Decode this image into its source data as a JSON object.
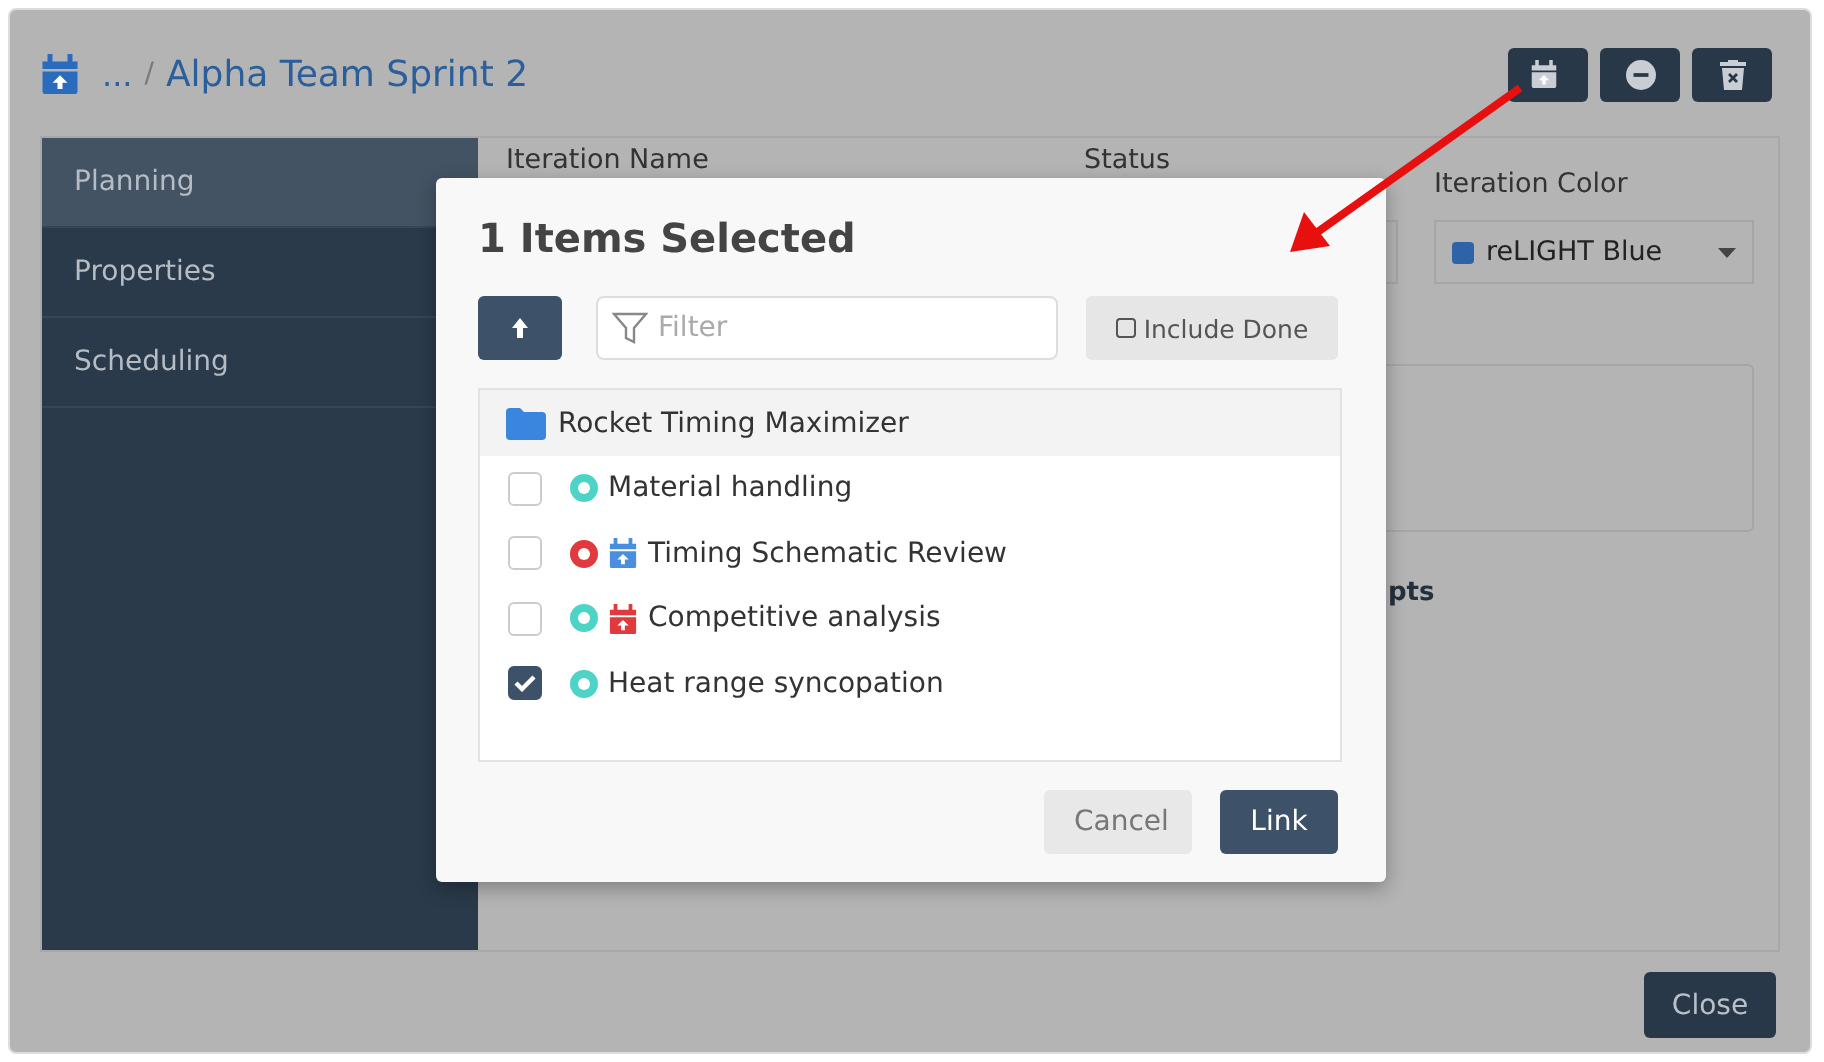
{
  "window": {
    "breadcrumb_ellipsis": "...",
    "breadcrumb_separator": "/",
    "title": "Alpha Team Sprint 2"
  },
  "sidebar": {
    "items": [
      {
        "label": "Planning",
        "selected": true
      },
      {
        "label": "Properties",
        "selected": false
      },
      {
        "label": "Scheduling",
        "selected": false
      }
    ]
  },
  "form": {
    "name_label": "Iteration Name",
    "status_label": "Status",
    "color_label": "Iteration Color",
    "color_value": "reLIGHT Blue",
    "section_heading_tail": "pts"
  },
  "dialog": {
    "title": "1 Items Selected",
    "filter": {
      "placeholder": "Filter"
    },
    "include_done": {
      "label": "Include Done",
      "checked": false
    },
    "group": "Rocket Timing Maximizer",
    "items": [
      {
        "label": "Material handling",
        "checked": false,
        "color": "#4dd4c6",
        "kind": "plain"
      },
      {
        "label": "Timing Schematic Review",
        "checked": false,
        "color": "#e0393e",
        "kind": "scheduled"
      },
      {
        "label": "Competitive analysis",
        "checked": false,
        "color": "#4dd4c6",
        "kind": "overdue"
      },
      {
        "label": "Heat range syncopation",
        "checked": true,
        "color": "#4dd4c6",
        "kind": "plain"
      }
    ],
    "buttons": [
      "Cancel",
      "Link"
    ]
  },
  "footer": {
    "button": "Close"
  }
}
